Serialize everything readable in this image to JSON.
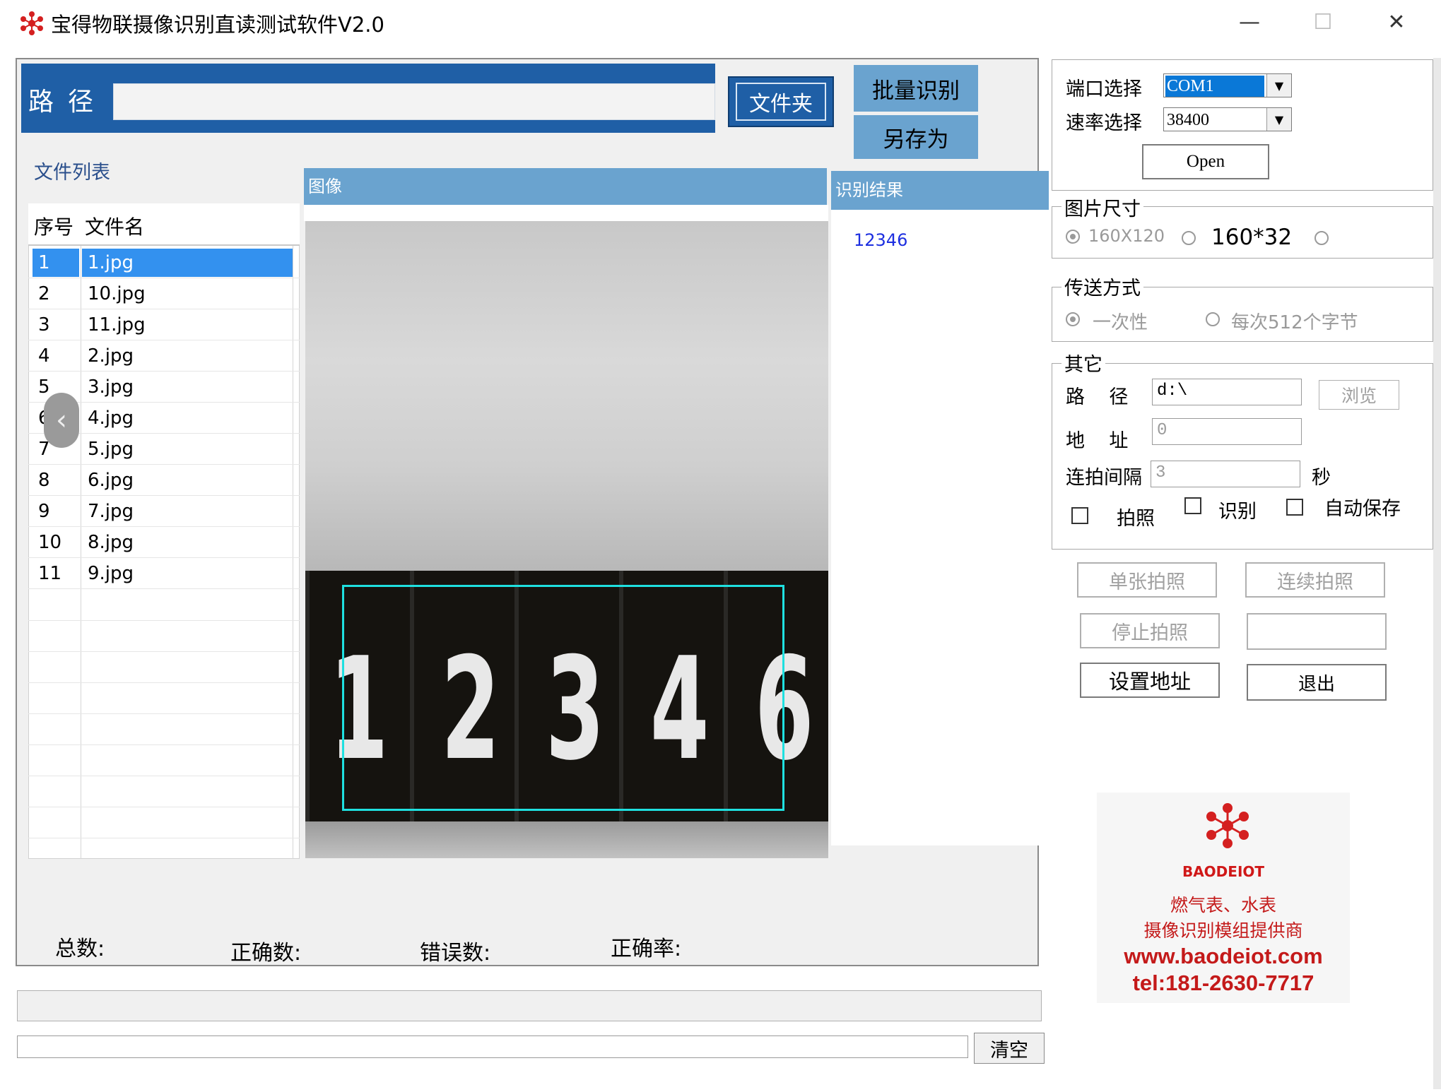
{
  "window": {
    "title": "宝得物联摄像识别直读测试软件V2.0",
    "minimize": "—",
    "maximize": "☐",
    "close": "✕"
  },
  "path": {
    "label": "路径",
    "value": "",
    "folder_button": "文件夹"
  },
  "actions": {
    "batch_recognize": "批量识别",
    "save_as": "另存为"
  },
  "file_list": {
    "caption": "文件列表",
    "columns": [
      "序号",
      "文件名"
    ],
    "rows": [
      {
        "no": "1",
        "name": "1.jpg"
      },
      {
        "no": "2",
        "name": "10.jpg"
      },
      {
        "no": "3",
        "name": "11.jpg"
      },
      {
        "no": "4",
        "name": "2.jpg"
      },
      {
        "no": "5",
        "name": "3.jpg"
      },
      {
        "no": "6",
        "name": "4.jpg"
      },
      {
        "no": "7",
        "name": "5.jpg"
      },
      {
        "no": "8",
        "name": "6.jpg"
      },
      {
        "no": "9",
        "name": "7.jpg"
      },
      {
        "no": "10",
        "name": "8.jpg"
      },
      {
        "no": "11",
        "name": "9.jpg"
      }
    ],
    "selected_index": 0
  },
  "image_panel": {
    "title": "图像",
    "digits": [
      "1",
      "2",
      "3",
      "4",
      "6"
    ]
  },
  "result_panel": {
    "title": "识别结果",
    "value": "12346"
  },
  "stats": {
    "total_label": "总数:",
    "correct_label": "正确数:",
    "error_label": "错误数:",
    "rate_label": "正确率:"
  },
  "bottom": {
    "log_value": "",
    "clear_button": "清空"
  },
  "serial": {
    "port_label": "端口选择",
    "port_value": "COM1",
    "baud_label": "速率选择",
    "baud_value": "38400",
    "open_button": "Open"
  },
  "image_size": {
    "title": "图片尺寸",
    "options": [
      "160X120",
      "160*32",
      ""
    ],
    "selected": "160X120"
  },
  "transfer": {
    "title": "传送方式",
    "options": [
      "一次性",
      "每次512个字节"
    ],
    "selected": "一次性"
  },
  "other": {
    "title": "其它",
    "path_label": "路    径",
    "path_value": "d:\\",
    "browse_button": "浏览",
    "address_label": "地    址",
    "address_value": "0",
    "interval_label": "连拍间隔",
    "interval_value": "3",
    "interval_unit": "秒",
    "check_photo": "拍照",
    "check_recognize": "识别",
    "check_autosave": "自动保存"
  },
  "controls": {
    "single_shot": "单张拍照",
    "continuous_shot": "连续拍照",
    "stop_shot": "停止拍照",
    "blank": "",
    "set_address": "设置地址",
    "exit": "退出"
  },
  "ad": {
    "brand": "BAODEIOT",
    "line1": "燃气表、水表",
    "line2": "摄像识别模组提供商",
    "website": "www.baodeiot.com",
    "tel": "tel:181-2630-7717"
  },
  "colors": {
    "header_blue": "#1f5fa6",
    "panel_blue": "#6aa3cf",
    "selection_blue": "#3391ef",
    "ad_red": "#c41a1a",
    "roi_cyan": "#1fe0e0"
  }
}
